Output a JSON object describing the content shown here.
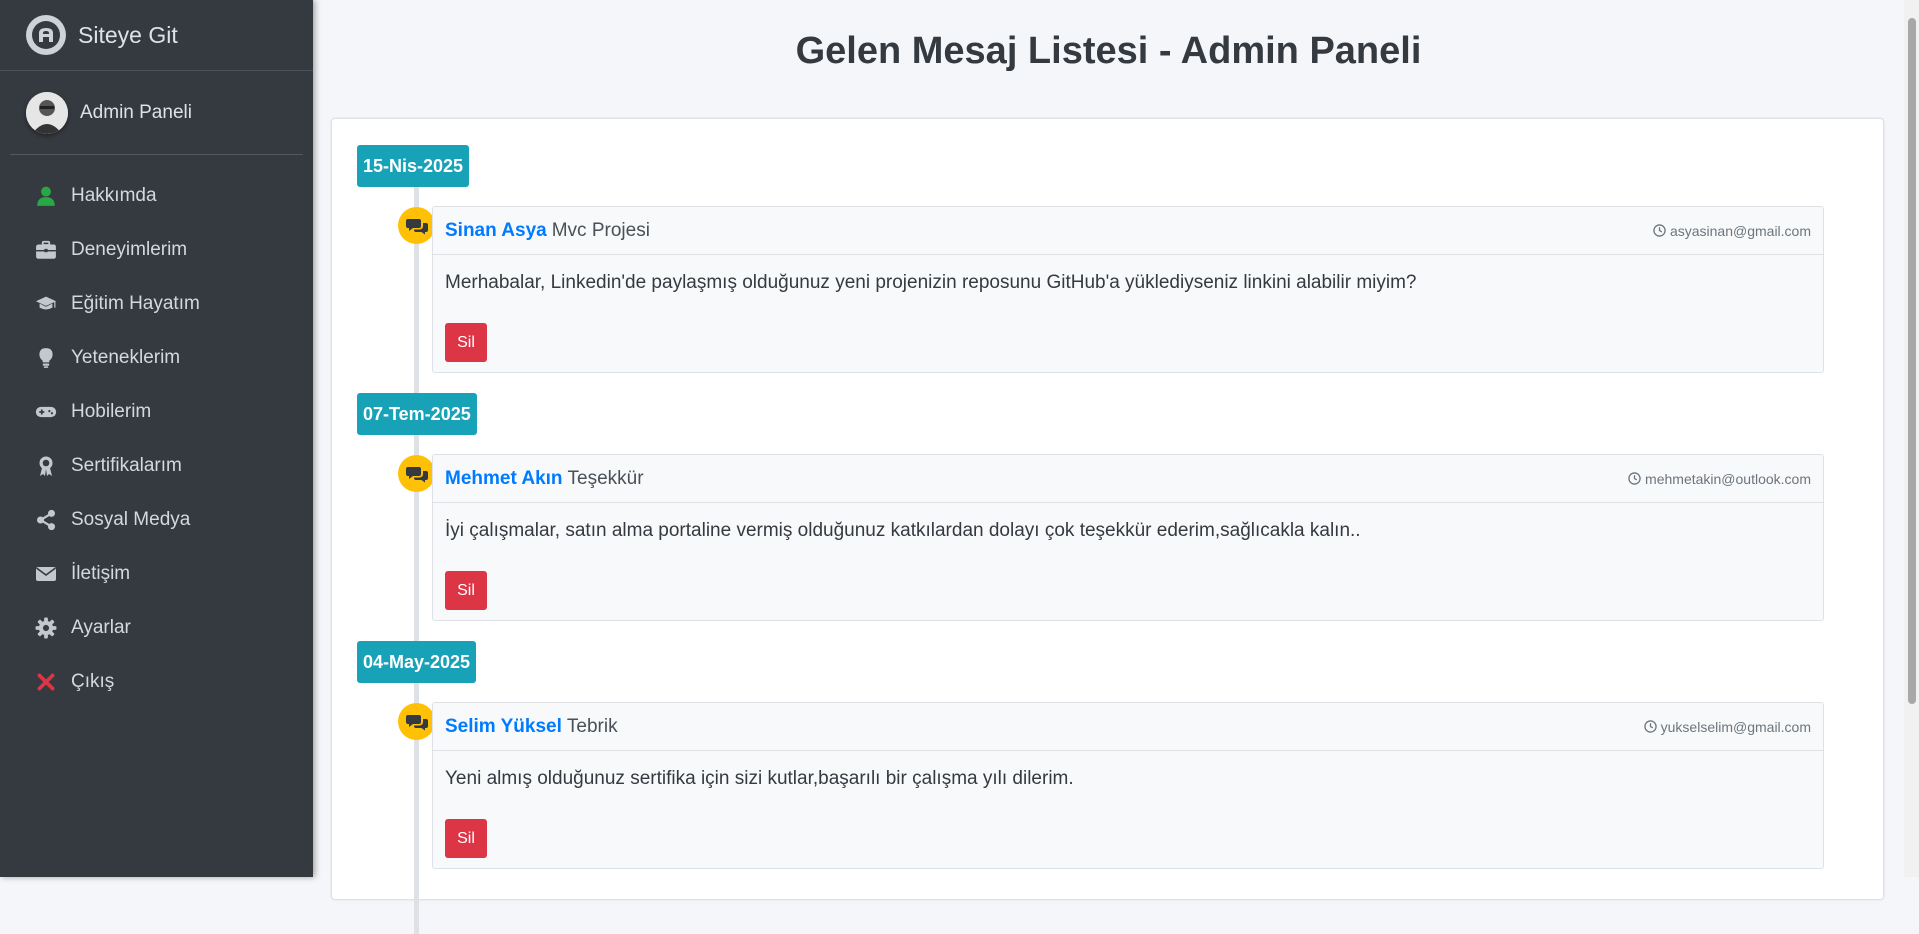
{
  "brand": {
    "label": "Siteye Git"
  },
  "user_panel": {
    "name": "Admin Paneli"
  },
  "sidebar": {
    "items": [
      {
        "label": "Hakkımda",
        "icon": "user-icon",
        "icon_color": "#28a745"
      },
      {
        "label": "Deneyimlerim",
        "icon": "briefcase-icon",
        "icon_color": "#c2c7d0"
      },
      {
        "label": "Eğitim Hayatım",
        "icon": "graduation-cap-icon",
        "icon_color": "#c2c7d0"
      },
      {
        "label": "Yeteneklerim",
        "icon": "lightbulb-icon",
        "icon_color": "#c2c7d0"
      },
      {
        "label": "Hobilerim",
        "icon": "gamepad-icon",
        "icon_color": "#c2c7d0"
      },
      {
        "label": "Sertifikalarım",
        "icon": "award-icon",
        "icon_color": "#c2c7d0"
      },
      {
        "label": "Sosyal Medya",
        "icon": "share-icon",
        "icon_color": "#c2c7d0"
      },
      {
        "label": "İletişim",
        "icon": "envelope-icon",
        "icon_color": "#c2c7d0"
      },
      {
        "label": "Ayarlar",
        "icon": "gear-icon",
        "icon_color": "#c2c7d0"
      },
      {
        "label": "Çıkış",
        "icon": "close-icon",
        "icon_color": "#dc3545"
      }
    ]
  },
  "main": {
    "title": "Gelen Mesaj Listesi - Admin Paneli",
    "messages": [
      {
        "date": "15-Nis-2025",
        "sender": "Sinan Asya",
        "subject": "Mvc Projesi",
        "email": "asyasinan@gmail.com",
        "body": "Merhabalar, Linkedin'de paylaşmış olduğunuz yeni projenizin reposunu GitHub'a yüklediyseniz linkini alabilir miyim?",
        "delete_label": "Sil"
      },
      {
        "date": "07-Tem-2025",
        "sender": "Mehmet Akın",
        "subject": "Teşekkür",
        "email": "mehmetakin@outlook.com",
        "body": "İyi çalışmalar, satın alma portaline vermiş olduğunuz katkılardan dolayı çok teşekkür ederim,sağlıcakla kalın..",
        "delete_label": "Sil"
      },
      {
        "date": "04-May-2025",
        "sender": "Selim Yüksel",
        "subject": "Tebrik",
        "email": "yukselselim@gmail.com",
        "body": "Yeni almış olduğunuz sertifika için sizi kutlar,başarılı bir çalışma yılı dilerim.",
        "delete_label": "Sil"
      }
    ]
  },
  "colors": {
    "sidebar_bg": "#343a40",
    "date_label_bg": "#17a2b8",
    "timeline_icon_bg": "#ffc107",
    "sender_color": "#007bff",
    "delete_button_bg": "#dc3545"
  }
}
